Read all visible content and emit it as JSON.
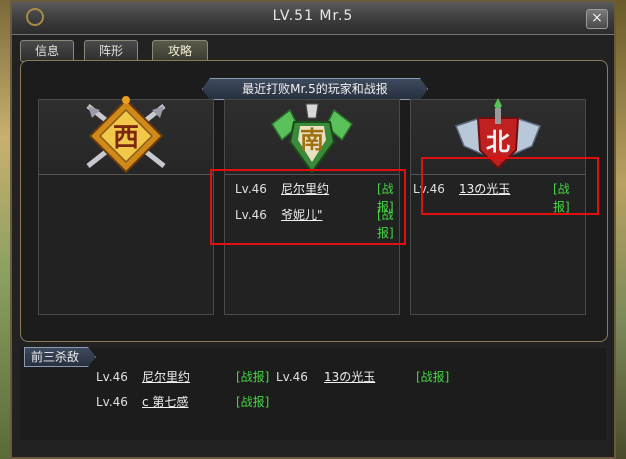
{
  "window": {
    "title": "LV.51  Mr.5",
    "close_label": "×"
  },
  "tabs": [
    {
      "label": "信息"
    },
    {
      "label": "阵形"
    },
    {
      "label": "攻略"
    }
  ],
  "banner": {
    "text": "最近打败Mr.5的玩家和战报"
  },
  "columns": [
    {
      "emblem": "西",
      "entries": []
    },
    {
      "emblem": "南",
      "entries": [
        {
          "level": "Lv.46",
          "name": "尼尔里约",
          "report": "[战报]"
        },
        {
          "level": "Lv.46",
          "name": "爷妮儿\"",
          "report": "[战报]"
        }
      ]
    },
    {
      "emblem": "北",
      "entries": [
        {
          "level": "Lv.46",
          "name": "13の光玉",
          "report": "[战报]"
        }
      ]
    }
  ],
  "top_kills": {
    "label": "前三杀敌",
    "entries": [
      {
        "level": "Lv.46",
        "name": "尼尔里约",
        "report": "[战报]"
      },
      {
        "level": "Lv.46",
        "name": "13の光玉",
        "report": "[战报]"
      },
      {
        "level": "Lv.46",
        "name": "c  第七感",
        "report": "[战报]"
      }
    ]
  },
  "colors": {
    "report_green": "#44d844",
    "highlight_red": "#e01010",
    "frame_gold": "#8a7a5a"
  }
}
